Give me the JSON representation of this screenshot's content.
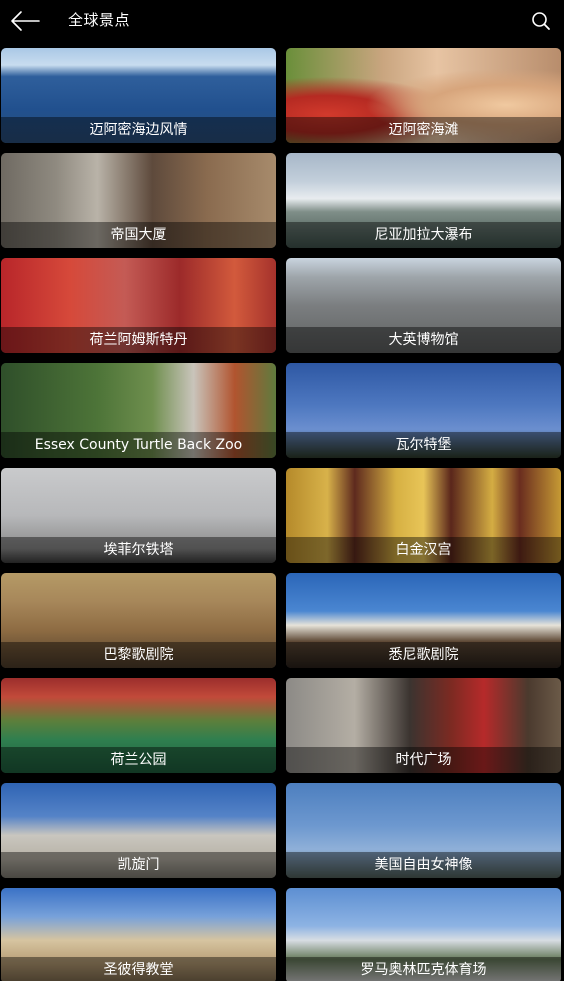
{
  "header": {
    "title": "全球景点",
    "back_icon": "arrow-left-icon",
    "search_icon": "search-icon"
  },
  "attractions": [
    {
      "name": "迈阿密海边风情",
      "scene": "s-miami-coast"
    },
    {
      "name": "迈阿密海滩",
      "scene": "s-miami-beach"
    },
    {
      "name": "帝国大厦",
      "scene": "s-empire"
    },
    {
      "name": "尼亚加拉大瀑布",
      "scene": "s-niagara"
    },
    {
      "name": "荷兰阿姆斯特丹",
      "scene": "s-amsterdam"
    },
    {
      "name": "大英博物馆",
      "scene": "s-museum"
    },
    {
      "name": "Essex County Turtle Back Zoo",
      "scene": "s-zoo"
    },
    {
      "name": "瓦尔特堡",
      "scene": "s-wartburg"
    },
    {
      "name": "埃菲尔铁塔",
      "scene": "s-eiffel"
    },
    {
      "name": "白金汉宫",
      "scene": "s-palace"
    },
    {
      "name": "巴黎歌剧院",
      "scene": "s-opera-paris"
    },
    {
      "name": "悉尼歌剧院",
      "scene": "s-sydney"
    },
    {
      "name": "荷兰公园",
      "scene": "s-garden"
    },
    {
      "name": "时代广场",
      "scene": "s-times"
    },
    {
      "name": "凯旋门",
      "scene": "s-arc"
    },
    {
      "name": "美国自由女神像",
      "scene": "s-liberty"
    },
    {
      "name": "圣彼得教堂",
      "scene": "s-stpeter"
    },
    {
      "name": "罗马奥林匹克体育场",
      "scene": "s-olympic"
    }
  ]
}
